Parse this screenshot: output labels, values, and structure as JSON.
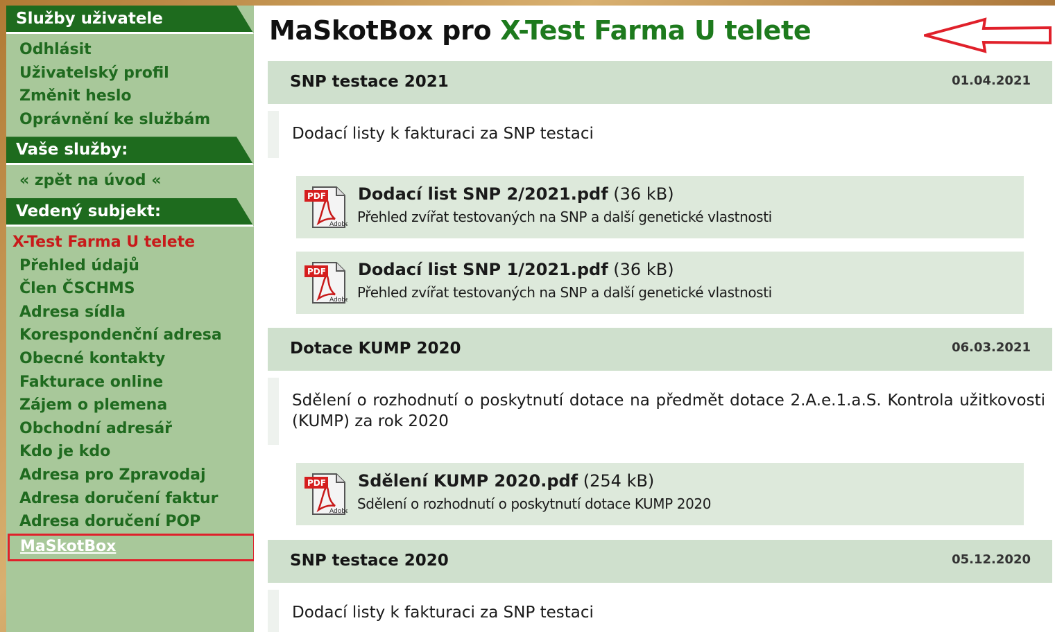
{
  "sidebar": {
    "sections": [
      {
        "header": "Služby uživatele",
        "links": [
          "Odhlásit",
          "Uživatelský profil",
          "Změnit heslo",
          "Oprávnění ke službám"
        ]
      },
      {
        "header": "Vaše služby:",
        "links": [
          "« zpět na úvod «"
        ]
      },
      {
        "header": "Vedený subjekt:",
        "current": "X-Test Farma U telete",
        "links": [
          "Přehled údajů",
          "Člen ČSCHMS",
          "Adresa sídla",
          "Korespondenční adresa",
          "Obecné kontakty",
          "Fakturace online",
          "Zájem o plemena",
          "Obchodní adresář",
          "Kdo je kdo",
          "Adresa pro Zpravodaj",
          "Adresa doručení faktur",
          "Adresa doručení POP"
        ],
        "active": "MaSkotBox"
      }
    ]
  },
  "main": {
    "title_prefix": "MaSkotBox pro ",
    "title_farm": "X-Test Farma U telete",
    "sections": [
      {
        "title": "SNP testace 2021",
        "date": "01.04.2021",
        "description": "Dodací listy k fakturaci za SNP testaci",
        "files": [
          {
            "name": "Dodací list SNP 2/2021.pdf",
            "size": "(36 kB)",
            "desc": "Přehled zvířat testovaných na SNP a další genetické vlastnosti"
          },
          {
            "name": "Dodací list SNP 1/2021.pdf",
            "size": "(36 kB)",
            "desc": "Přehled zvířat testovaných na SNP a další genetické vlastnosti"
          }
        ]
      },
      {
        "title": "Dotace KUMP 2020",
        "date": "06.03.2021",
        "description": "Sdělení o rozhodnutí o poskytnutí dotace na předmět dotace 2.A.e.1.a.S. Kontrola užitkovosti (KUMP) za rok 2020",
        "files": [
          {
            "name": "Sdělení KUMP 2020.pdf",
            "size": "(254 kB)",
            "desc": "Sdělení o rozhodnutí o poskytnutí dotace KUMP 2020"
          }
        ]
      },
      {
        "title": "SNP testace 2020",
        "date": "05.12.2020",
        "description": "Dodací listy k fakturaci za SNP testaci",
        "files": []
      }
    ]
  },
  "icons": {
    "file_icon": "pdf-icon",
    "pdf_badge": "PDF",
    "pdf_brand": "Adobe",
    "annotation": "red-arrow-left-icon"
  },
  "colors": {
    "sidebar_bg": "#a8c89a",
    "sidebar_header": "#1e6b1e",
    "link": "#1f6a1f",
    "current_subject": "#c81a1a",
    "section_header_bg": "#cfe0cd",
    "file_bg": "#dde9db",
    "annotation_red": "#e0202a"
  }
}
